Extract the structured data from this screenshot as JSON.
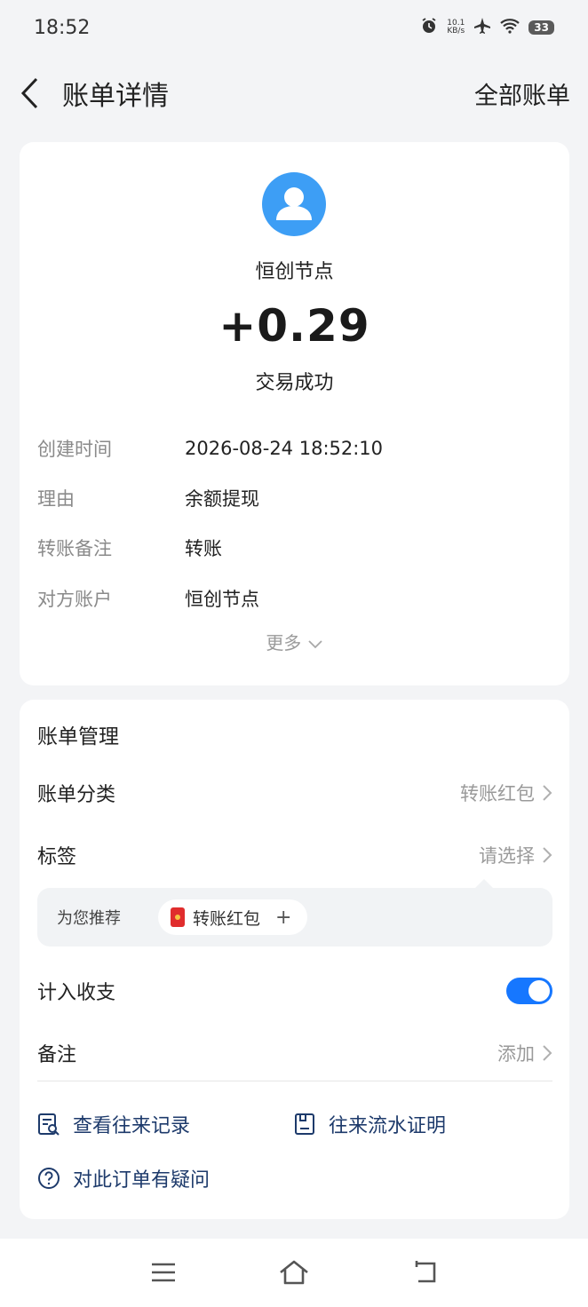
{
  "status_bar": {
    "time": "18:52",
    "net_speed_value": "10.1",
    "net_speed_unit": "KB/s",
    "battery": "33",
    "icons": [
      "alarm-icon",
      "airplane-icon",
      "wifi-icon",
      "battery-icon"
    ]
  },
  "header": {
    "title": "账单详情",
    "right_link": "全部账单"
  },
  "summary": {
    "payee": "恒创节点",
    "amount": "+0.29",
    "status": "交易成功",
    "avatar_color": "#3d9ef5"
  },
  "details": [
    {
      "label": "创建时间",
      "value": "2026-08-24 18:52:10"
    },
    {
      "label": "理由",
      "value": "余额提现"
    },
    {
      "label": "转账备注",
      "value": "转账"
    },
    {
      "label": "对方账户",
      "value": "恒创节点"
    }
  ],
  "more_label": "更多",
  "management": {
    "title": "账单管理",
    "category_label": "账单分类",
    "category_value": "转账红包",
    "tag_label": "标签",
    "tag_value": "请选择",
    "recommend_label": "为您推荐",
    "recommend_chip": "转账红包",
    "include_label": "计入收支",
    "include_enabled": true,
    "note_label": "备注",
    "note_value": "添加",
    "link_records": "查看往来记录",
    "link_proof": "往来流水证明",
    "link_question": "对此订单有疑问"
  },
  "colors": {
    "accent": "#1677ff",
    "link_text": "#1d3a6b",
    "background": "#f3f4f6"
  }
}
